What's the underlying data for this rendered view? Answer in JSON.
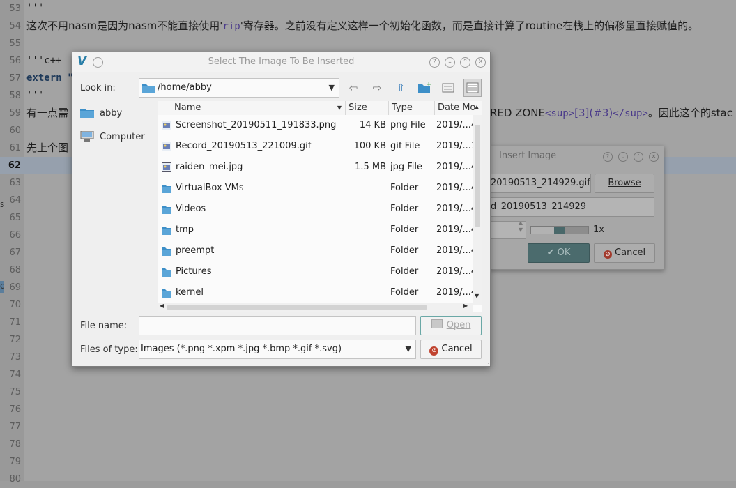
{
  "editor": {
    "lines": [
      {
        "n": "53",
        "text": "'''",
        "mono": true
      },
      {
        "n": "54",
        "text_parts": [
          "这次不用nasm是因为nasm不能直接使用'",
          "rip",
          "'寄存器。之前没有定义这样一个初始化函数，而是直接计算了routine在栈上的偏移量直接赋值的。"
        ]
      },
      {
        "n": "55",
        "text": ""
      },
      {
        "n": "56",
        "text": "'''c++",
        "mono": true
      },
      {
        "n": "57",
        "text": "extern \"",
        "mono": true
      },
      {
        "n": "58",
        "text": "'''",
        "mono": true
      },
      {
        "n": "59",
        "text_left": "有一点需",
        "text_right_parts": [
          "RED ZONE",
          "<sup>",
          "[3](#3)",
          "</sup>",
          "。因此这个的stac"
        ]
      },
      {
        "n": "60",
        "text": ""
      },
      {
        "n": "61",
        "text": "先上个图"
      },
      {
        "n": "62",
        "text": "",
        "current": true
      },
      {
        "n": "63",
        "text": ""
      },
      {
        "n": "64",
        "text": ""
      },
      {
        "n": "65",
        "text": ""
      },
      {
        "n": "66",
        "text": ""
      },
      {
        "n": "67",
        "text": ""
      },
      {
        "n": "68",
        "text": ""
      },
      {
        "n": "69",
        "text": ""
      },
      {
        "n": "70",
        "text": ""
      },
      {
        "n": "71",
        "text": ""
      },
      {
        "n": "72",
        "text": ""
      },
      {
        "n": "73",
        "text": ""
      },
      {
        "n": "74",
        "text": ""
      },
      {
        "n": "75",
        "text": ""
      },
      {
        "n": "76",
        "text": ""
      },
      {
        "n": "77",
        "text": ""
      },
      {
        "n": "78",
        "text": ""
      },
      {
        "n": "79",
        "text": ""
      },
      {
        "n": "80",
        "text": ""
      }
    ],
    "gutter_marks": [
      "s",
      "c"
    ]
  },
  "insert_dialog": {
    "title": "Insert Image",
    "file_value": "20190513_214929.gif",
    "browse_label": "Browse",
    "name_value": "d_20190513_214929",
    "scale_label": "1x",
    "scale_level": 0.5,
    "ok_label": "OK",
    "cancel_label": "Cancel"
  },
  "file_dialog": {
    "title": "Select The Image To Be Inserted",
    "look_in_label": "Look in:",
    "look_in_value": "/home/abby",
    "places": [
      {
        "label": "abby",
        "icon": "folder-icon"
      },
      {
        "label": "Computer",
        "icon": "computer-icon"
      }
    ],
    "columns": [
      "Name",
      "Size",
      "Type",
      "Date Mo"
    ],
    "rows": [
      {
        "name": "Screenshot_20190511_191833.png",
        "size": "14 KB",
        "type": "png File",
        "date": "2019/...4",
        "icon": "image-file-icon"
      },
      {
        "name": "Record_20190513_221009.gif",
        "size": "100 KB",
        "type": "gif File",
        "date": "2019/...1",
        "icon": "image-file-icon"
      },
      {
        "name": "raiden_mei.jpg",
        "size": "1.5 MB",
        "type": "jpg File",
        "date": "2019/...4",
        "icon": "image-file-icon"
      },
      {
        "name": "VirtualBox VMs",
        "size": "",
        "type": "Folder",
        "date": "2019/...4",
        "icon": "folder-icon"
      },
      {
        "name": "Videos",
        "size": "",
        "type": "Folder",
        "date": "2019/...4",
        "icon": "folder-icon"
      },
      {
        "name": "tmp",
        "size": "",
        "type": "Folder",
        "date": "2019/...4",
        "icon": "folder-icon"
      },
      {
        "name": "preempt",
        "size": "",
        "type": "Folder",
        "date": "2019/...4",
        "icon": "folder-icon"
      },
      {
        "name": "Pictures",
        "size": "",
        "type": "Folder",
        "date": "2019/...4",
        "icon": "folder-icon"
      },
      {
        "name": "kernel",
        "size": "",
        "type": "Folder",
        "date": "2019/...4",
        "icon": "folder-icon"
      }
    ],
    "file_name_label": "File name:",
    "file_name_value": "",
    "open_label": "Open",
    "files_of_type_label": "Files of type:",
    "files_of_type_value": "Images (*.png *.xpm *.jpg *.bmp *.gif *.svg)",
    "cancel_label": "Cancel"
  },
  "colors": {
    "accent": "#4b6b6d",
    "folder": "#3d8fc8",
    "logo": "#2a7fa8"
  }
}
